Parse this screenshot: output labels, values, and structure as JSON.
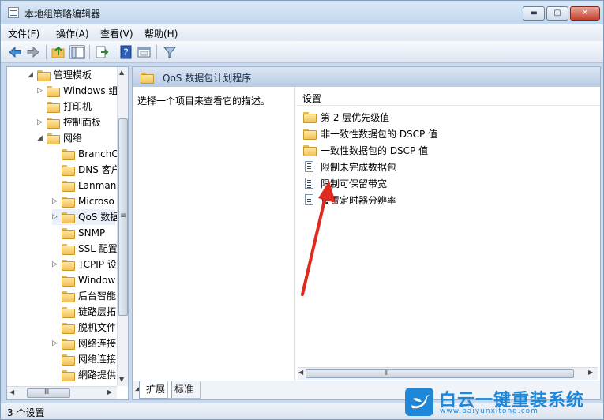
{
  "window": {
    "title": "本地组策略编辑器",
    "controls": {
      "minimize": "▬",
      "maximize": "▢",
      "close": "✕"
    }
  },
  "menu": {
    "items": [
      "文件(F)",
      "操作(A)",
      "查看(V)",
      "帮助(H)"
    ]
  },
  "toolbar": {
    "icons": [
      "back-arrow-icon",
      "forward-arrow-icon",
      "up-folder-icon",
      "show-tree-icon",
      "export-list-icon",
      "help-icon",
      "properties-icon",
      "filter-icon"
    ]
  },
  "tree": {
    "items": [
      {
        "label": "管理模板",
        "twisty": "◢"
      },
      {
        "label": "Windows 组",
        "twisty": "▷"
      },
      {
        "label": "打印机",
        "twisty": ""
      },
      {
        "label": "控制面板",
        "twisty": "▷"
      },
      {
        "label": "网络",
        "twisty": "◢"
      },
      {
        "label": "BranchC",
        "twisty": ""
      },
      {
        "label": "DNS 客户",
        "twisty": ""
      },
      {
        "label": "Lanman",
        "twisty": ""
      },
      {
        "label": "Microso",
        "twisty": "▷"
      },
      {
        "label": "QoS 数据",
        "twisty": "▷"
      },
      {
        "label": "SNMP",
        "twisty": ""
      },
      {
        "label": "SSL 配置",
        "twisty": ""
      },
      {
        "label": "TCPIP 设",
        "twisty": "▷"
      },
      {
        "label": "Window",
        "twisty": ""
      },
      {
        "label": "后台智能",
        "twisty": ""
      },
      {
        "label": "链路层拓",
        "twisty": ""
      },
      {
        "label": "脱机文件",
        "twisty": ""
      },
      {
        "label": "网络连接",
        "twisty": "▷"
      },
      {
        "label": "网络连接",
        "twisty": ""
      },
      {
        "label": "網路提供",
        "twisty": ""
      }
    ],
    "scroll_grip": "≡",
    "hscroll_grip": "Ⅲ"
  },
  "panel": {
    "title": "QoS 数据包计划程序",
    "description": "选择一个项目来查看它的描述。",
    "column_header": "设置",
    "items": [
      {
        "label": "第 2 层优先级值",
        "type": "folder"
      },
      {
        "label": "非一致性数据包的 DSCP 值",
        "type": "folder"
      },
      {
        "label": "一致性数据包的 DSCP 值",
        "type": "folder"
      },
      {
        "label": "限制未完成数据包",
        "type": "setting"
      },
      {
        "label": "限制可保留带宽",
        "type": "setting"
      },
      {
        "label": "设置定时器分辨率",
        "type": "setting"
      }
    ],
    "hscroll_grip": "Ⅲ"
  },
  "tabs": [
    {
      "label": "扩展",
      "active": true
    },
    {
      "label": "标准",
      "active": false
    }
  ],
  "status": {
    "text": "3 个设置"
  },
  "watermark": {
    "brand": "白云一键重装系统",
    "url": "www.baiyunxitong.com"
  },
  "colors": {
    "accent": "#1e87d8",
    "annotation_arrow": "#e02a1f",
    "folder": "#f2c158"
  }
}
